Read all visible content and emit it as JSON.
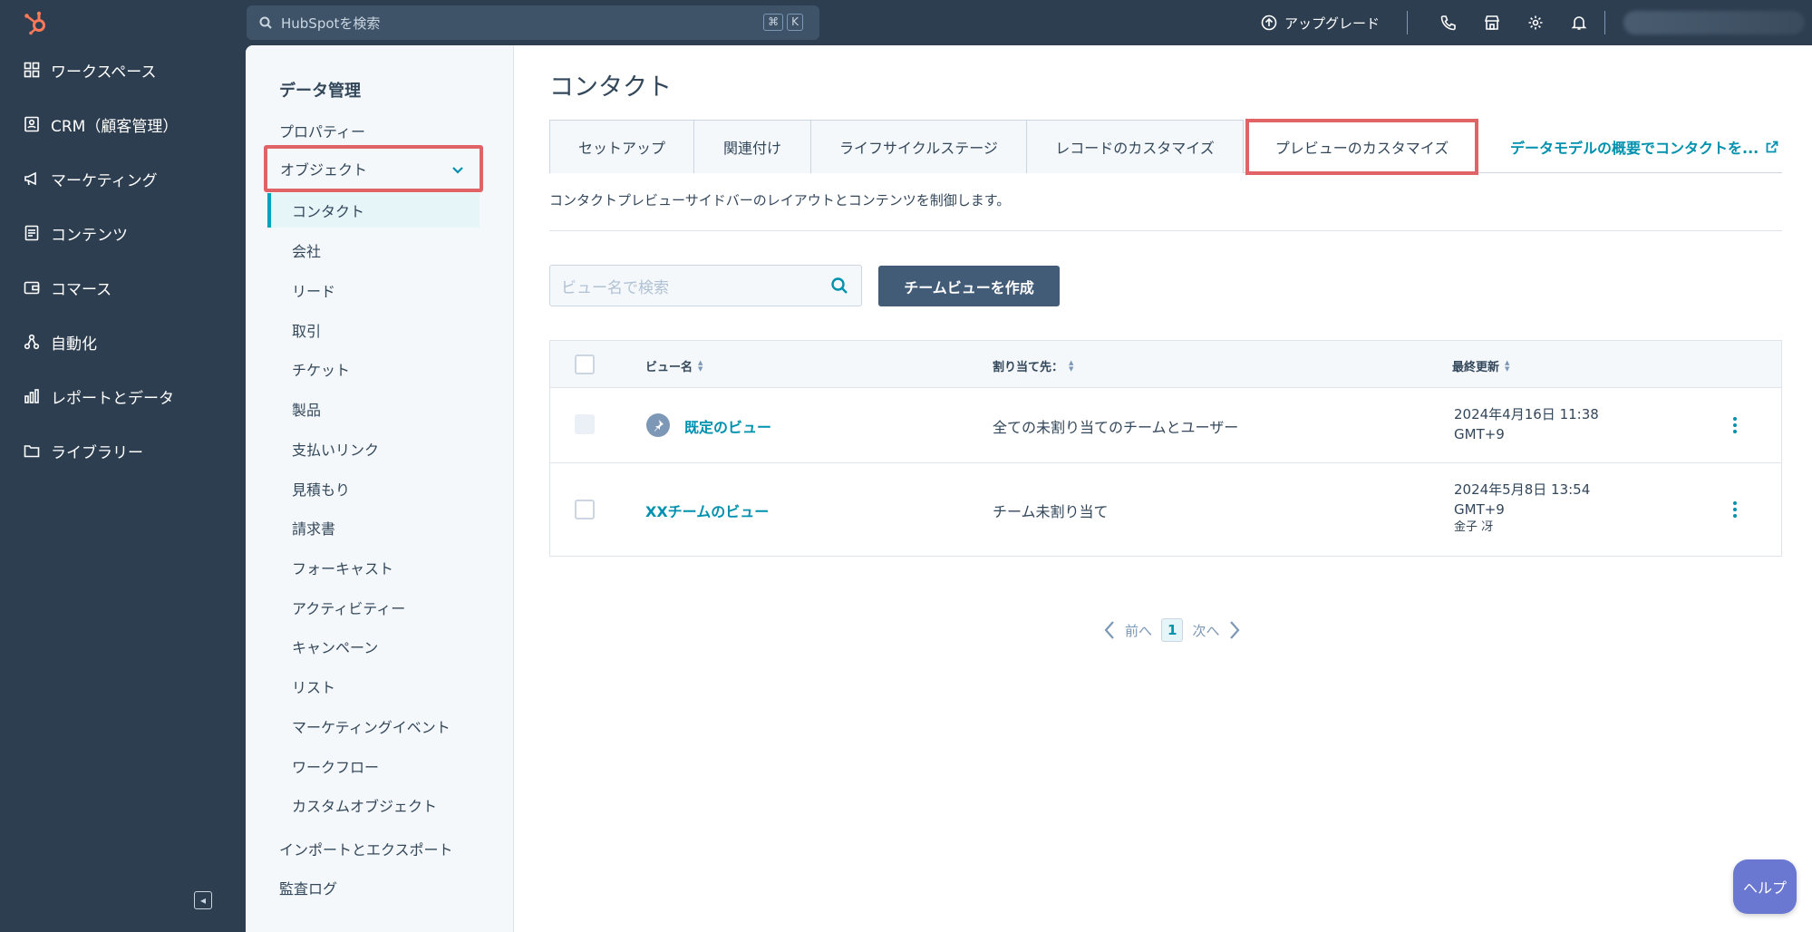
{
  "search": {
    "placeholder": "HubSpotを検索",
    "kbd_cmd": "⌘",
    "kbd_key": "K"
  },
  "topbar": {
    "upgrade_label": "アップグレード"
  },
  "nav": {
    "items": [
      {
        "label": "ワークスペース",
        "icon": "grid-icon"
      },
      {
        "label": "CRM（顧客管理）",
        "icon": "contact-card-icon"
      },
      {
        "label": "マーケティング",
        "icon": "megaphone-icon"
      },
      {
        "label": "コンテンツ",
        "icon": "document-icon"
      },
      {
        "label": "コマース",
        "icon": "wallet-icon"
      },
      {
        "label": "自動化",
        "icon": "workflow-icon"
      },
      {
        "label": "レポートとデータ",
        "icon": "bar-chart-icon"
      },
      {
        "label": "ライブラリー",
        "icon": "folder-icon"
      }
    ]
  },
  "settings": {
    "title": "データ管理",
    "properties": "プロパティー",
    "objects": "オブジェクト",
    "sub_items": [
      "コンタクト",
      "会社",
      "リード",
      "取引",
      "チケット",
      "製品",
      "支払いリンク",
      "見積もり",
      "請求書",
      "フォーキャスト",
      "アクティビティー",
      "キャンペーン",
      "リスト",
      "マーケティングイベント",
      "ワークフロー",
      "カスタムオブジェクト"
    ],
    "import_export": "インポートとエクスポート",
    "audit_log": "監査ログ"
  },
  "page": {
    "title": "コンタクト",
    "tabs": [
      "セットアップ",
      "関連付け",
      "ライフサイクルステージ",
      "レコードのカスタマイズ",
      "プレビューのカスタマイズ"
    ],
    "tab_link": "データモデルの概要でコンタクトを...",
    "description": "コンタクトプレビューサイドバーのレイアウトとコンテンツを制御します。",
    "view_search_placeholder": "ビュー名で検索",
    "create_button": "チームビューを作成"
  },
  "table": {
    "headers": [
      "ビュー名",
      "割り当て先：",
      "最終更新"
    ],
    "rows": [
      {
        "name": "既定のビュー",
        "assigned": "全ての未割り当てのチームとユーザー",
        "date": "2024年4月16日 11:38",
        "tz": "GMT+9",
        "user": ""
      },
      {
        "name": "XXチームのビュー",
        "assigned": "チーム未割り当て",
        "date": "2024年5月8日 13:54",
        "tz": "GMT+9",
        "user": "金子 冴"
      }
    ]
  },
  "pager": {
    "prev": "前へ",
    "page": "1",
    "next": "次へ"
  },
  "help_label": "ヘルプ",
  "colors": {
    "nav_bg": "#2d3e50",
    "accent": "#0091ae",
    "highlight": "#e06366",
    "button": "#425b76"
  }
}
